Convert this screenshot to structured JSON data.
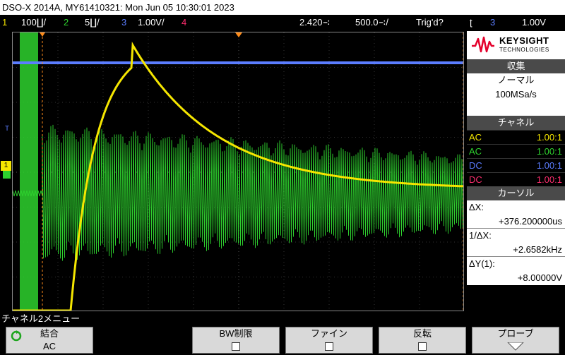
{
  "title_bar": "DSO-X 2014A, MY61410321: Mon Jun 05 10:30:01 2023",
  "status": {
    "ch1_num": "1",
    "ch1_scale": "100∐/",
    "ch2_num": "2",
    "ch2_scale": "5∐/",
    "ch3_num": "3",
    "ch3_scale": "1.00V/",
    "ch4_num": "4",
    "delay": "2.420∹",
    "timebase": "500.0∹/",
    "trigger_status": "Trig'd?",
    "trigger_icon": "ʈ",
    "trigger_source": "3",
    "trigger_level": "1.00V"
  },
  "colors": {
    "ch1": "#f5e600",
    "ch2": "#2ed22e",
    "ch3": "#5b7dff",
    "ch4": "#ff2d6e"
  },
  "panel": {
    "brand": "KEYSIGHT",
    "brand_sub": "TECHNOLOGIES",
    "acquisition_header": "収集",
    "acquisition_mode": "ノーマル",
    "sample_rate": "100MSa/s",
    "channel_header": "チャネル",
    "channels": [
      {
        "coupling": "AC",
        "ratio": "1.00:1"
      },
      {
        "coupling": "AC",
        "ratio": "1.00:1"
      },
      {
        "coupling": "DC",
        "ratio": "1.00:1"
      },
      {
        "coupling": "DC",
        "ratio": "1.00:1"
      }
    ],
    "cursor_header": "カーソル",
    "cursor": {
      "dx_label": "ΔX:",
      "dx_value": "+376.200000us",
      "inv_dx_label": "1/ΔX:",
      "inv_dx_value": "+2.6582kHz",
      "dy_label": "ΔY(1):",
      "dy_value": "+8.00000V"
    }
  },
  "menu_title": "チャネル2メニュー",
  "softkeys": [
    {
      "label": "結合",
      "value": "AC"
    },
    {
      "label": "BW制限"
    },
    {
      "label": "ファイン"
    },
    {
      "label": "反転"
    },
    {
      "label": "プローブ"
    }
  ]
}
